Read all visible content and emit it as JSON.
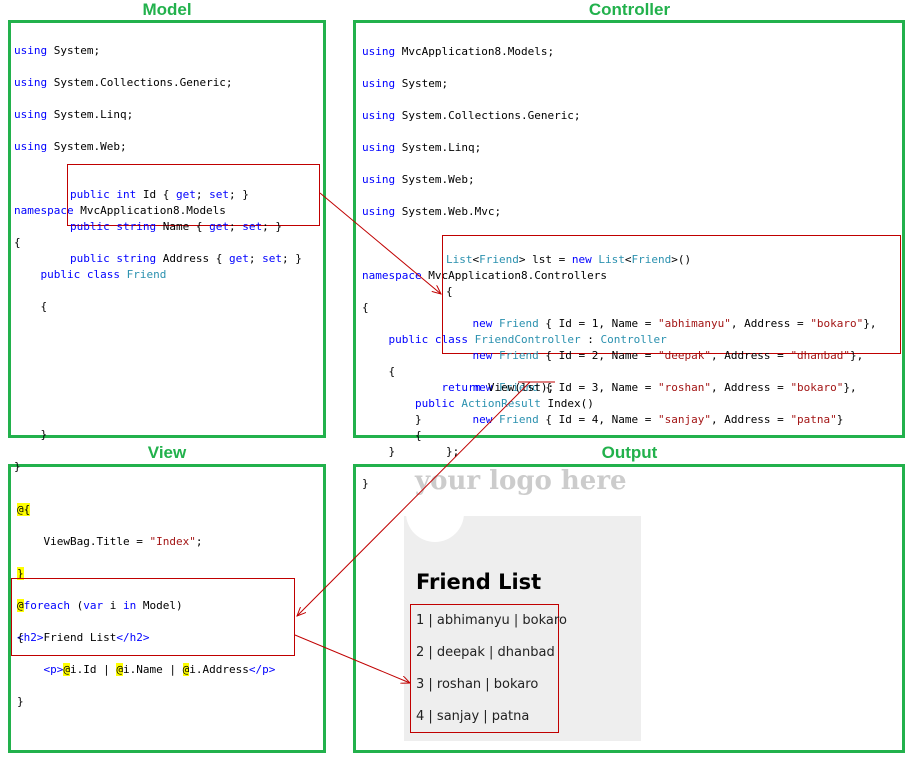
{
  "panels": {
    "model": {
      "title": "Model"
    },
    "controller": {
      "title": "Controller"
    },
    "view": {
      "title": "View"
    },
    "output": {
      "title": "Output"
    }
  },
  "model_code": {
    "l1": [
      "using",
      " System;"
    ],
    "l2": [
      "using",
      " System.Collections.Generic;"
    ],
    "l3": [
      "using",
      " System.Linq;"
    ],
    "l4": [
      "using",
      " System.Web;"
    ],
    "l6": [
      "namespace",
      " MvcApplication8.Models"
    ],
    "l7": "{",
    "l8": [
      "    ",
      "public",
      " ",
      "class",
      " ",
      "Friend"
    ],
    "l9": "    {",
    "p1": [
      "public",
      " ",
      "int",
      " Id { ",
      "get",
      "; ",
      "set",
      "; }"
    ],
    "p2": [
      "public",
      " ",
      "string",
      " Name { ",
      "get",
      "; ",
      "set",
      "; }"
    ],
    "p3": [
      "public",
      " ",
      "string",
      " Address { ",
      "get",
      "; ",
      "set",
      "; }"
    ],
    "l13": "    }",
    "l14": "}"
  },
  "controller_code": {
    "l1": [
      "using",
      " MvcApplication8.Models;"
    ],
    "l2": [
      "using",
      " System;"
    ],
    "l3": [
      "using",
      " System.Collections.Generic;"
    ],
    "l4": [
      "using",
      " System.Linq;"
    ],
    "l5": [
      "using",
      " System.Web;"
    ],
    "l6": [
      "using",
      " System.Web.Mvc;"
    ],
    "l8": [
      "namespace",
      " MvcApplication8.Controllers"
    ],
    "l9": "{",
    "l10": [
      "    ",
      "public",
      " ",
      "class",
      " ",
      "FriendController",
      " : ",
      "Controller"
    ],
    "l11": "    {",
    "l12": [
      "        ",
      "public",
      " ",
      "ActionResult",
      " Index()"
    ],
    "l13": "        {",
    "list1": [
      "List",
      "<",
      "Friend",
      "> lst = ",
      "new",
      " ",
      "List",
      "<",
      "Friend",
      ">()"
    ],
    "list2": "{",
    "f1": [
      "    ",
      "new",
      " ",
      "Friend",
      " { Id = 1, Name = ",
      "\"abhimanyu\"",
      ", Address = ",
      "\"bokaro\"",
      "},"
    ],
    "f2": [
      "    ",
      "new",
      " ",
      "Friend",
      " { Id = 2, Name = ",
      "\"deepak\"",
      ", Address = ",
      "\"dhanbad\"",
      "},"
    ],
    "f3": [
      "    ",
      "new",
      " ",
      "Friend",
      " { Id = 3, Name = ",
      "\"roshan\"",
      ", Address = ",
      "\"bokaro\"",
      "},"
    ],
    "f4": [
      "    ",
      "new",
      " ",
      "Friend",
      " { Id = 4, Name = ",
      "\"sanjay\"",
      ", Address = ",
      "\"patna\"",
      "}"
    ],
    "list_end": "};",
    "ret": [
      "            ",
      "return",
      " View(lst);"
    ],
    "c1": "        }",
    "c2": "    }",
    "c3": "}"
  },
  "view_code": {
    "l1": [
      "@",
      "{"
    ],
    "l2": [
      "    ViewBag.Title = ",
      "\"Index\"",
      ";"
    ],
    "l3": [
      "}"
    ],
    "l5": [
      "<h2>",
      "Friend List",
      "</h2>"
    ],
    "fe1": [
      "@",
      "foreach",
      " (",
      "var",
      " i ",
      "in",
      " Model)"
    ],
    "fe2": "{",
    "fe3": [
      "    ",
      "<p>",
      "@",
      "i.Id | ",
      "@",
      "i.Name | ",
      "@",
      "i.Address",
      "</p>"
    ],
    "fe4": "}"
  },
  "output": {
    "logo": "your logo here",
    "heading": "Friend List",
    "items": [
      "1 | abhimanyu | bokaro",
      "2 | deepak | dhanbad",
      "3 | roshan | bokaro",
      "4 | sanjay | patna"
    ]
  },
  "colors": {
    "panel_border": "#22b14c",
    "highlight_box": "#c00000",
    "arrow": "#c00000",
    "keyword": "#0000ff",
    "type": "#2b91af",
    "string": "#a31515",
    "razor_at": "#ffff00"
  }
}
